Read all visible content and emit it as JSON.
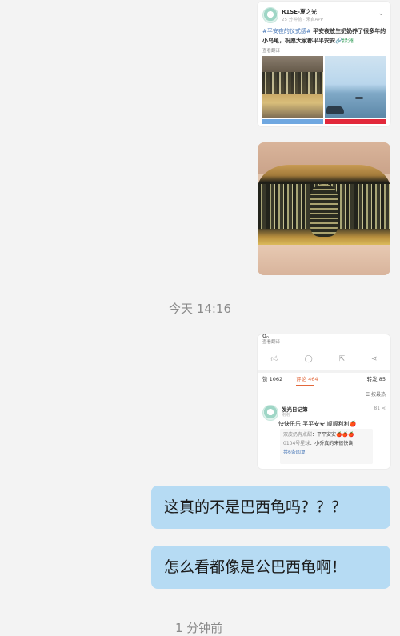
{
  "card1": {
    "name": "R1SE-夏之光",
    "meta": "25 分钟前 · 来自APP",
    "text_tag": "#平安夜的仪式感#",
    "text_bold": " 平安夜放生奶奶养了很多年的小乌龟，祝愿大家都平平安安",
    "text_link": "🔗绿洲",
    "translate": "查看翻译"
  },
  "timestamps": {
    "first": "今天 14:16",
    "second": "1 分钟前"
  },
  "card2": {
    "dot": "ó。",
    "translate": "查看翻译",
    "actions": [
      "thumb-icon",
      "comment-icon",
      "share-out-icon",
      "share-icon"
    ],
    "stats": {
      "likes": "赞 1062",
      "comments": "评论 464",
      "reposts": "转发 85"
    },
    "sort": "☰ 按最热",
    "commenter": "发光日记簿",
    "commenter_meta": "刚刚",
    "comment_like": "81",
    "comment_text": "快快乐乐 平平安安 顺顺利利🍎",
    "replies": [
      {
        "name": "双皮奶有点甜",
        "text": "：平平安安🍎🍎🍎"
      },
      {
        "name": "0104号星球",
        "text": "：小乔真的来很快诶"
      }
    ],
    "more_replies": "共6条回复"
  },
  "messages": [
    {
      "text": "这真的不是巴西龟吗？？？"
    },
    {
      "text": "怎么看都像是公巴西龟啊！"
    }
  ]
}
